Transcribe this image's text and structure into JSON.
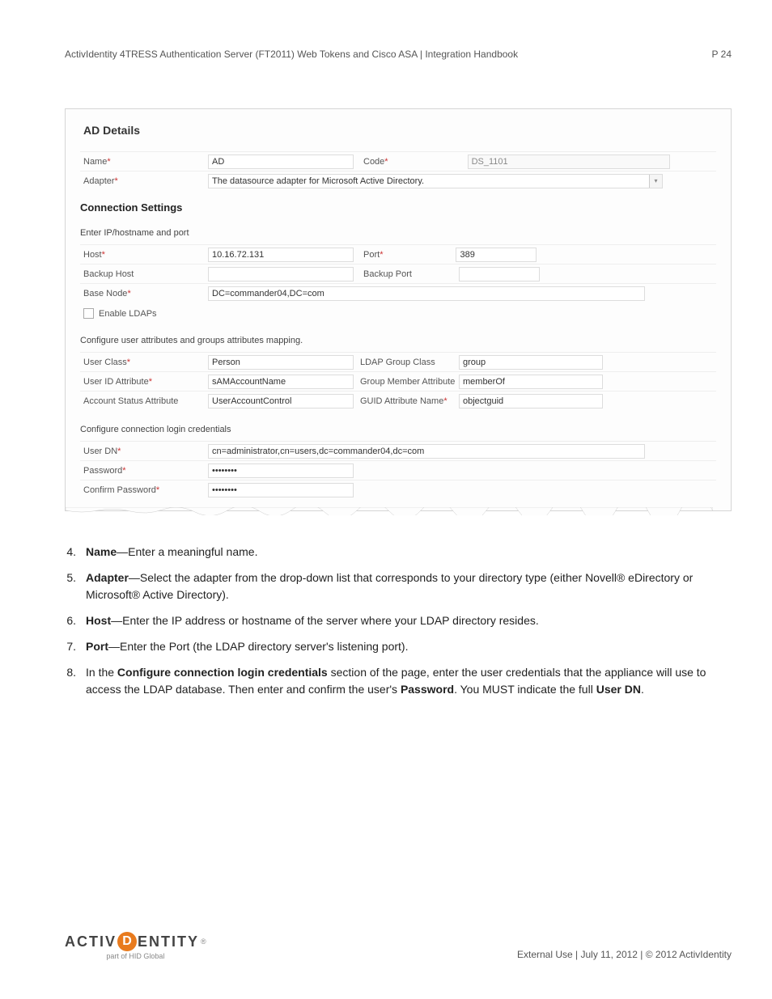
{
  "header": {
    "title": "ActivIdentity 4TRESS Authentication Server (FT2011) Web Tokens and Cisco ASA | Integration Handbook",
    "page": "P 24"
  },
  "panel": {
    "title": "AD Details",
    "name_label": "Name",
    "name_value": "AD",
    "code_label": "Code",
    "code_value": "DS_1101",
    "adapter_label": "Adapter",
    "adapter_value": "The datasource adapter for Microsoft Active Directory.",
    "section_connection": "Connection Settings",
    "sub_ip": "Enter IP/hostname and port",
    "host_label": "Host",
    "host_value": "10.16.72.131",
    "port_label": "Port",
    "port_value": "389",
    "backup_host_label": "Backup Host",
    "backup_host_value": "",
    "backup_port_label": "Backup Port",
    "backup_port_value": "",
    "basenode_label": "Base Node",
    "basenode_value": "DC=commander04,DC=com",
    "enable_ldaps": "Enable LDAPs",
    "sub_attrs": "Configure user attributes and groups attributes mapping.",
    "userclass_label": "User Class",
    "userclass_value": "Person",
    "ldapgroup_label": "LDAP Group Class",
    "ldapgroup_value": "group",
    "useridattr_label": "User ID Attribute",
    "useridattr_value": "sAMAccountName",
    "groupmember_label": "Group Member Attribute",
    "groupmember_value": "memberOf",
    "accountstatus_label": "Account Status Attribute",
    "accountstatus_value": "UserAccountControl",
    "guidattr_label": "GUID Attribute Name",
    "guidattr_value": "objectguid",
    "sub_creds": "Configure connection login credentials",
    "userdn_label": "User DN",
    "userdn_value": "cn=administrator,cn=users,dc=commander04,dc=com",
    "password_label": "Password",
    "password_value": "••••••••",
    "confirm_label": "Confirm Password",
    "confirm_value": "••••••••"
  },
  "instructions": [
    {
      "num": "4.",
      "bold": "Name",
      "text": "—Enter a meaningful name."
    },
    {
      "num": "5.",
      "bold": "Adapter",
      "text": "—Select the adapter from the drop-down list that corresponds to your directory type (either Novell® eDirectory or Microsoft® Active Directory)."
    },
    {
      "num": "6.",
      "bold": "Host",
      "text": "—Enter the IP address or hostname of the server where your LDAP directory resides."
    },
    {
      "num": "7.",
      "bold": "Port",
      "text": "—Enter the Port (the LDAP directory server's listening port)."
    }
  ],
  "instruction8": {
    "num": "8.",
    "prefix": "In the ",
    "bold1": "Configure connection login credentials",
    "mid1": " section of the page, enter the user credentials that the appliance will use to access the LDAP database. Then enter and confirm the user's ",
    "bold2": "Password",
    "mid2": ". You MUST indicate the full ",
    "bold3": "User DN",
    "end": "."
  },
  "footer": {
    "text": "External Use | July 11, 2012 | © 2012 ActivIdentity",
    "logo_part1": "ACTIV",
    "logo_d": "D",
    "logo_part2": "ENTITY",
    "logo_sub": "part of HID Global"
  }
}
